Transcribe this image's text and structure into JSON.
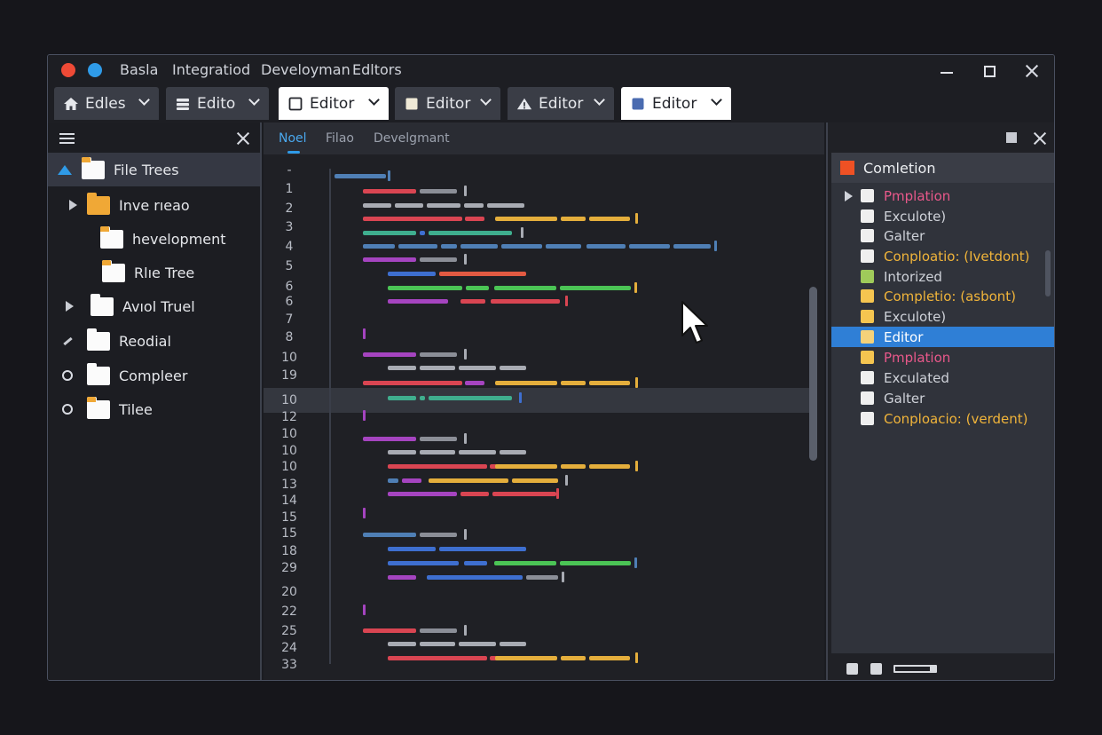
{
  "titlebar": {
    "words": [
      "Basla",
      "Integratiod",
      "Develoyman",
      "Edltors"
    ]
  },
  "tabs": [
    {
      "label": "Edles",
      "icon": "home-icon",
      "style": "dark"
    },
    {
      "label": "Edito",
      "icon": "stack-icon",
      "style": "dark"
    },
    {
      "label": "Editor",
      "icon": "square-icon",
      "style": "light"
    },
    {
      "label": "Editor",
      "icon": "square-icon",
      "style": "dark"
    },
    {
      "label": "Editor",
      "icon": "warning-icon",
      "style": "dark"
    },
    {
      "label": "Editor",
      "icon": "square-icon",
      "style": "light"
    }
  ],
  "file_tree": {
    "items": [
      {
        "label": "File Trees",
        "selected": true
      },
      {
        "label": "Inve rıeao"
      },
      {
        "label": "hevelopment"
      },
      {
        "label": "Rlıe Tree"
      },
      {
        "label": "Avıol Truel"
      },
      {
        "label": "Reodial"
      },
      {
        "label": "Compleer"
      },
      {
        "label": "Tilee"
      }
    ]
  },
  "editor": {
    "tabs": [
      "Noel",
      "Filao",
      "Develgmant"
    ],
    "line_numbers": [
      "-",
      "1",
      "2",
      "3",
      "4",
      "5",
      "6",
      "6",
      "7",
      "8",
      "10",
      "19",
      "10",
      "12",
      "10",
      "10",
      "10",
      "13",
      "14",
      "15",
      "15",
      "18",
      "29",
      "20",
      "22",
      "25",
      "24",
      "33"
    ]
  },
  "completion": {
    "title": "Comletion",
    "items": [
      {
        "label": "Pmplation",
        "color": "#e8588a",
        "box": "#efefef"
      },
      {
        "label": "Exculote)",
        "color": "#cfd2d9",
        "box": "#efefef"
      },
      {
        "label": "Galter",
        "color": "#cfd2d9",
        "box": "#efefef"
      },
      {
        "label": "Conploatio: (Ivetdont)",
        "color": "#f0b43a",
        "box": "#efefef"
      },
      {
        "label": "Intorized",
        "color": "#cfd2d9",
        "box": "#9fca5a"
      },
      {
        "label": "Completio: (asbont)",
        "color": "#f0b43a",
        "box": "#f5c550"
      },
      {
        "label": "Exculote)",
        "color": "#cfd2d9",
        "box": "#f5c550"
      },
      {
        "label": "Editor",
        "color": "#ffffff",
        "box": "#f5d27a",
        "selected": true
      },
      {
        "label": "Pmplation",
        "color": "#e8588a",
        "box": "#f5c550"
      },
      {
        "label": "Exculated",
        "color": "#cfd2d9",
        "box": "#efefef"
      },
      {
        "label": "Galter",
        "color": "#cfd2d9",
        "box": "#efefef"
      },
      {
        "label": "Conploacio: (verdent)",
        "color": "#f0b43a",
        "box": "#efefef"
      }
    ]
  },
  "colors": {
    "accent": "#2f9be8",
    "selection": "#2f7fd6",
    "close_dot": "#ee4a36",
    "completion_icon": "#ef5124"
  }
}
